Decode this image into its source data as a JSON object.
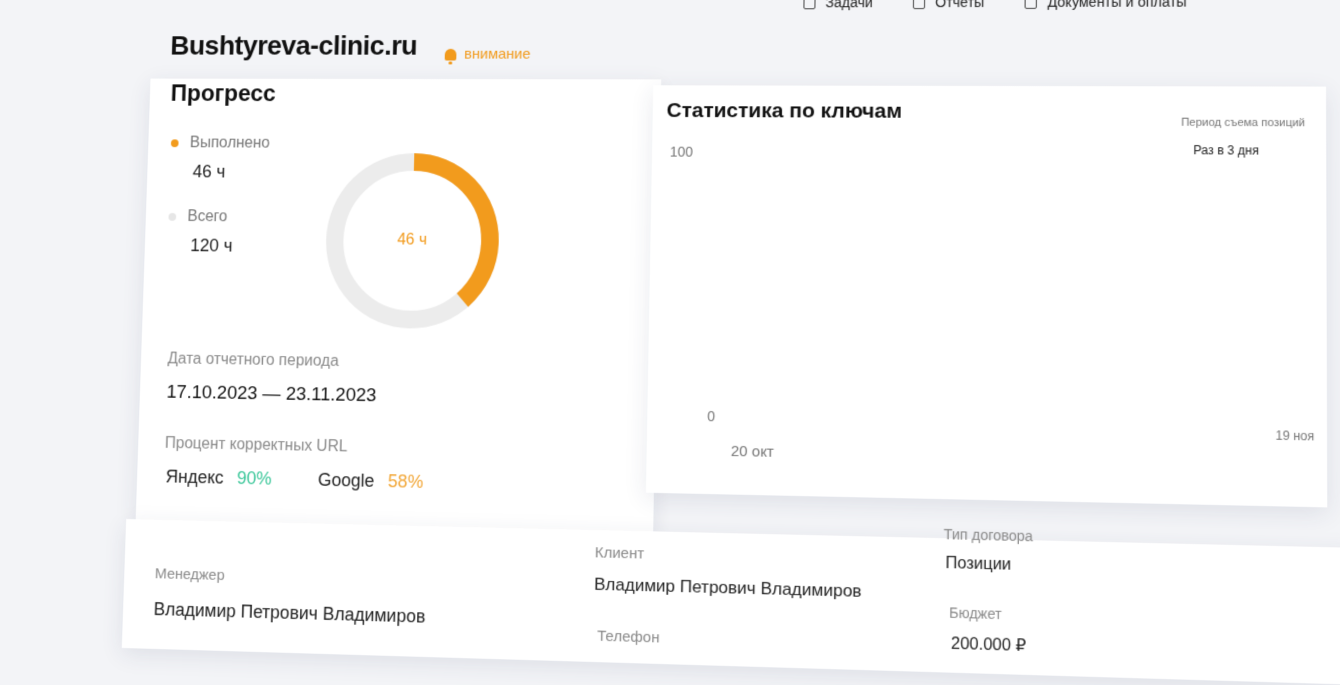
{
  "nav": {
    "items": [
      {
        "label": "Задачи",
        "icon": "tasks-icon"
      },
      {
        "label": "Отчеты",
        "icon": "report-icon"
      },
      {
        "label": "Документы и оплаты",
        "icon": "documents-icon"
      }
    ]
  },
  "header": {
    "brand": "Bushtyreva-clinic.ru",
    "alert_label": "внимание"
  },
  "progress": {
    "title": "Прогресс",
    "done_label": "Выполнено",
    "done_value": "46 ч",
    "total_label": "Всего",
    "total_value": "120 ч",
    "center_label": "46 ч",
    "done_hours": 46,
    "total_hours": 120,
    "period_label": "Дата отчетного периода",
    "period_value": "17.10.2023 — 23.11.2023",
    "url_label": "Процент корректных URL",
    "yandex_label": "Яндекс",
    "yandex_pct": "90%",
    "google_label": "Google",
    "google_pct": "58%"
  },
  "stats": {
    "title": "Статистика по ключам",
    "period_label": "Период съема позиций",
    "period_value": "Раз в 3 дня"
  },
  "chart_data": {
    "type": "line",
    "title": "Статистика по ключам",
    "ylim": [
      0,
      100
    ],
    "y_ticks": [
      "100",
      "0"
    ],
    "x_ticks": [
      "20 окт",
      "19 ноя"
    ],
    "series": []
  },
  "info": {
    "manager_label": "Менеджер",
    "manager_value": "Владимир Петрович Владимиров",
    "client_label": "Клиент",
    "client_value": "Владимир Петрович Владимиров",
    "phone_label": "Телефон",
    "contract_label": "Тип договора",
    "contract_value": "Позиции",
    "budget_label": "Бюджет",
    "budget_value": "200.000 ₽"
  },
  "colors": {
    "accent": "#f29b1d",
    "track": "#ececec",
    "yandex": "#3cc79a",
    "google": "#f2a738"
  }
}
